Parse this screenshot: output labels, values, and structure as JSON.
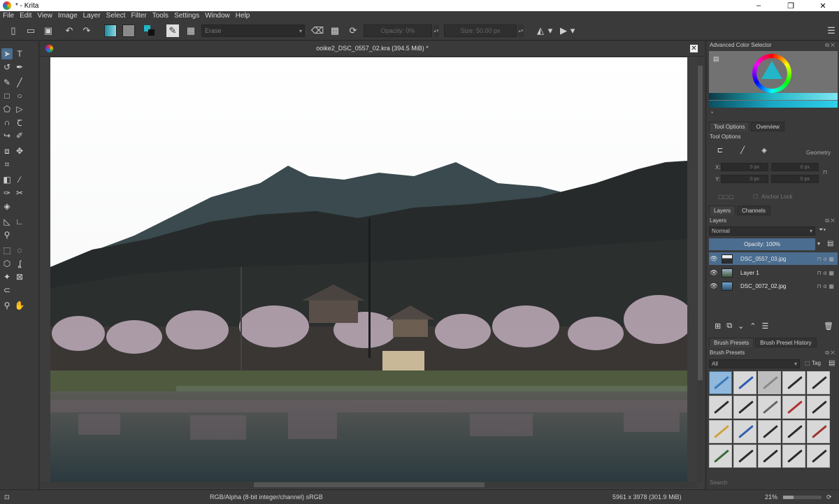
{
  "window": {
    "title": "* - Krita",
    "minimize": "–",
    "restore": "❐",
    "close": "✕"
  },
  "menu": [
    "File",
    "Edit",
    "View",
    "Image",
    "Layer",
    "Select",
    "Filter",
    "Tools",
    "Settings",
    "Window",
    "Help"
  ],
  "toolbar": {
    "blend_mode": "Erase",
    "opacity_label": "Opacity:  0%",
    "size_label": "Size:  50.00 px"
  },
  "document": {
    "title": "ooike2_DSC_0557_02.kra (394.5 MiB) *",
    "close": "✕"
  },
  "dock": {
    "color_selector_title": "Advanced Color Selector",
    "tool_options_tab": "Tool Options",
    "overview_tab": "Overview",
    "tool_options_title": "Tool Options",
    "geometry_label": "Geometry",
    "x_label": "X:",
    "y_label": "Y:",
    "x_value": "0 px",
    "x2_value": "0 px",
    "y_value": "0 px",
    "y2_value": "0 px",
    "anchor_lock": "Anchor Lock",
    "layers_tab": "Layers",
    "channels_tab": "Channels",
    "layers_title": "Layers",
    "blend_mode": "Normal",
    "layer_opacity": "Opacity:  100%",
    "layers": [
      {
        "name": "DSC_0557_03.jpg",
        "selected": true
      },
      {
        "name": "Layer 1",
        "selected": false
      },
      {
        "name": "DSC_0072_02.jpg",
        "selected": false
      }
    ],
    "brush_presets_tab": "Brush Presets",
    "brush_history_tab": "Brush Preset History",
    "brush_presets_title": "Brush Presets",
    "preset_filter": "All",
    "tag_label": "Tag",
    "search_label": "Search"
  },
  "status": {
    "color_space": "RGB/Alpha (8-bit integer/channel)  sRGB",
    "image_size": "5961 x 3978 (301.9 MiB)",
    "zoom": "21%"
  },
  "colors": {
    "accent": "#4b6d8f",
    "panel": "#3a3a3a",
    "foreground_color": "#21b7c8"
  }
}
